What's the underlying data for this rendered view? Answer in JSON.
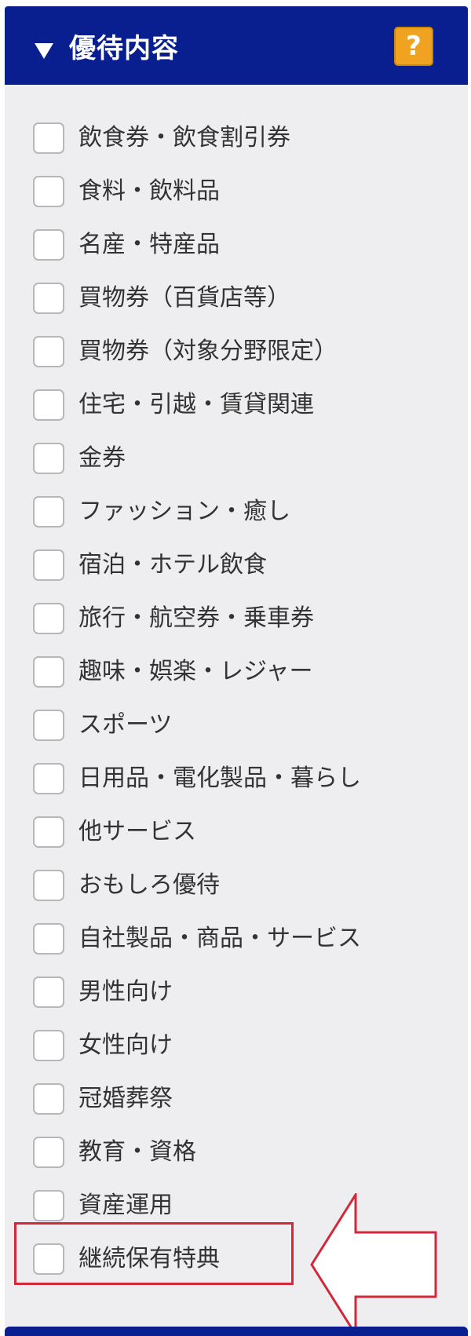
{
  "header": {
    "title": "優待内容",
    "help_label": "?"
  },
  "items": [
    {
      "label": "飲食券・飲食割引券"
    },
    {
      "label": "食料・飲料品"
    },
    {
      "label": "名産・特産品"
    },
    {
      "label": "買物券（百貨店等）"
    },
    {
      "label": "買物券（対象分野限定）"
    },
    {
      "label": "住宅・引越・賃貸関連"
    },
    {
      "label": "金券"
    },
    {
      "label": "ファッション・癒し"
    },
    {
      "label": "宿泊・ホテル飲食"
    },
    {
      "label": "旅行・航空券・乗車券"
    },
    {
      "label": "趣味・娯楽・レジャー"
    },
    {
      "label": "スポーツ"
    },
    {
      "label": "日用品・電化製品・暮らし"
    },
    {
      "label": "他サービス"
    },
    {
      "label": "おもしろ優待"
    },
    {
      "label": "自社製品・商品・サービス"
    },
    {
      "label": "男性向け"
    },
    {
      "label": "女性向け"
    },
    {
      "label": "冠婚葬祭"
    },
    {
      "label": "教育・資格"
    },
    {
      "label": "資産運用"
    },
    {
      "label": "継続保有特典"
    }
  ],
  "colors": {
    "header_bg": "#0a1f8f",
    "help_bg": "#f0a320",
    "highlight": "#d2283a",
    "panel_bg": "#eeeef0"
  },
  "icons": {
    "toggle": "triangle-down-icon",
    "help": "question-mark-icon",
    "annotation": "arrow-left-icon"
  }
}
